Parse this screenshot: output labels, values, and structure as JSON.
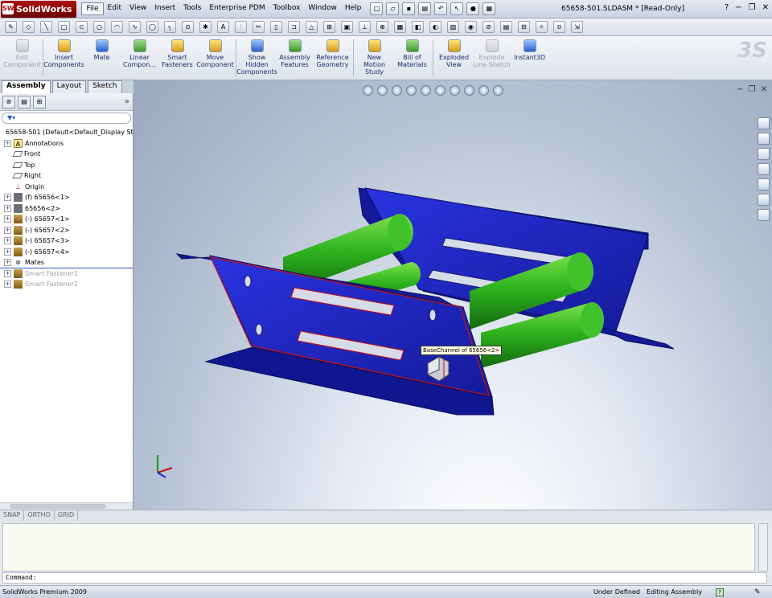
{
  "app": {
    "name": "SolidWorks",
    "document_title": "65658-501.SLDASM * [Read-Only]"
  },
  "menu": [
    "File",
    "Edit",
    "View",
    "Insert",
    "Tools",
    "Enterprise PDM",
    "Toolbox",
    "Window",
    "Help"
  ],
  "command_manager": [
    {
      "label": "Edit Component",
      "enabled": false
    },
    {
      "label": "Insert Components",
      "enabled": true
    },
    {
      "label": "Mate",
      "enabled": true
    },
    {
      "label": "Linear Compon...",
      "enabled": true
    },
    {
      "label": "Smart Fasteners",
      "enabled": true
    },
    {
      "label": "Move Component",
      "enabled": true
    },
    {
      "label": "Show Hidden Components",
      "enabled": true
    },
    {
      "label": "Assembly Features",
      "enabled": true
    },
    {
      "label": "Reference Geometry",
      "enabled": true
    },
    {
      "label": "New Motion Study",
      "enabled": true
    },
    {
      "label": "Bill of Materials",
      "enabled": true
    },
    {
      "label": "Exploded View",
      "enabled": true
    },
    {
      "label": "Explode Line Sketch",
      "enabled": false
    },
    {
      "label": "Instant3D",
      "enabled": true
    }
  ],
  "tabs": [
    "Assembly",
    "Layout",
    "Sketch"
  ],
  "tree": {
    "root": "65658-501  (Default<Default_Display St",
    "items": [
      {
        "label": "Annotations",
        "type": "anno",
        "expandable": true
      },
      {
        "label": "Front",
        "type": "plane",
        "expandable": false
      },
      {
        "label": "Top",
        "type": "plane",
        "expandable": false
      },
      {
        "label": "Right",
        "type": "plane",
        "expandable": false
      },
      {
        "label": "Origin",
        "type": "origin",
        "expandable": false
      },
      {
        "label": "(f) 65656<1>",
        "type": "fixed",
        "expandable": true
      },
      {
        "label": "65656<2>",
        "type": "fixed",
        "expandable": true
      },
      {
        "label": "(-) 65657<1>",
        "type": "part",
        "expandable": true
      },
      {
        "label": "(-) 65657<2>",
        "type": "part",
        "expandable": true
      },
      {
        "label": "(-) 65657<3>",
        "type": "part",
        "expandable": true
      },
      {
        "label": "(-) 65657<4>",
        "type": "part",
        "expandable": true
      },
      {
        "label": "Mates",
        "type": "mates",
        "expandable": true
      },
      {
        "label": "Smart Fastener1",
        "type": "grey",
        "expandable": true
      },
      {
        "label": "Smart Fastener2",
        "type": "grey",
        "expandable": true
      }
    ]
  },
  "graphics": {
    "tooltip": "BaseChannel of 65656<2>",
    "colors": {
      "channel": "#1c24c8",
      "rod": "#1fa81a",
      "background": "#b8c3d6"
    }
  },
  "snapbar": [
    "SNAP",
    "ORTHO",
    "GRID"
  ],
  "command_line": {
    "prompt": "Command:"
  },
  "status": {
    "product": "SolidWorks Premium 2009",
    "definition": "Under Defined",
    "mode": "Editing Assembly"
  }
}
